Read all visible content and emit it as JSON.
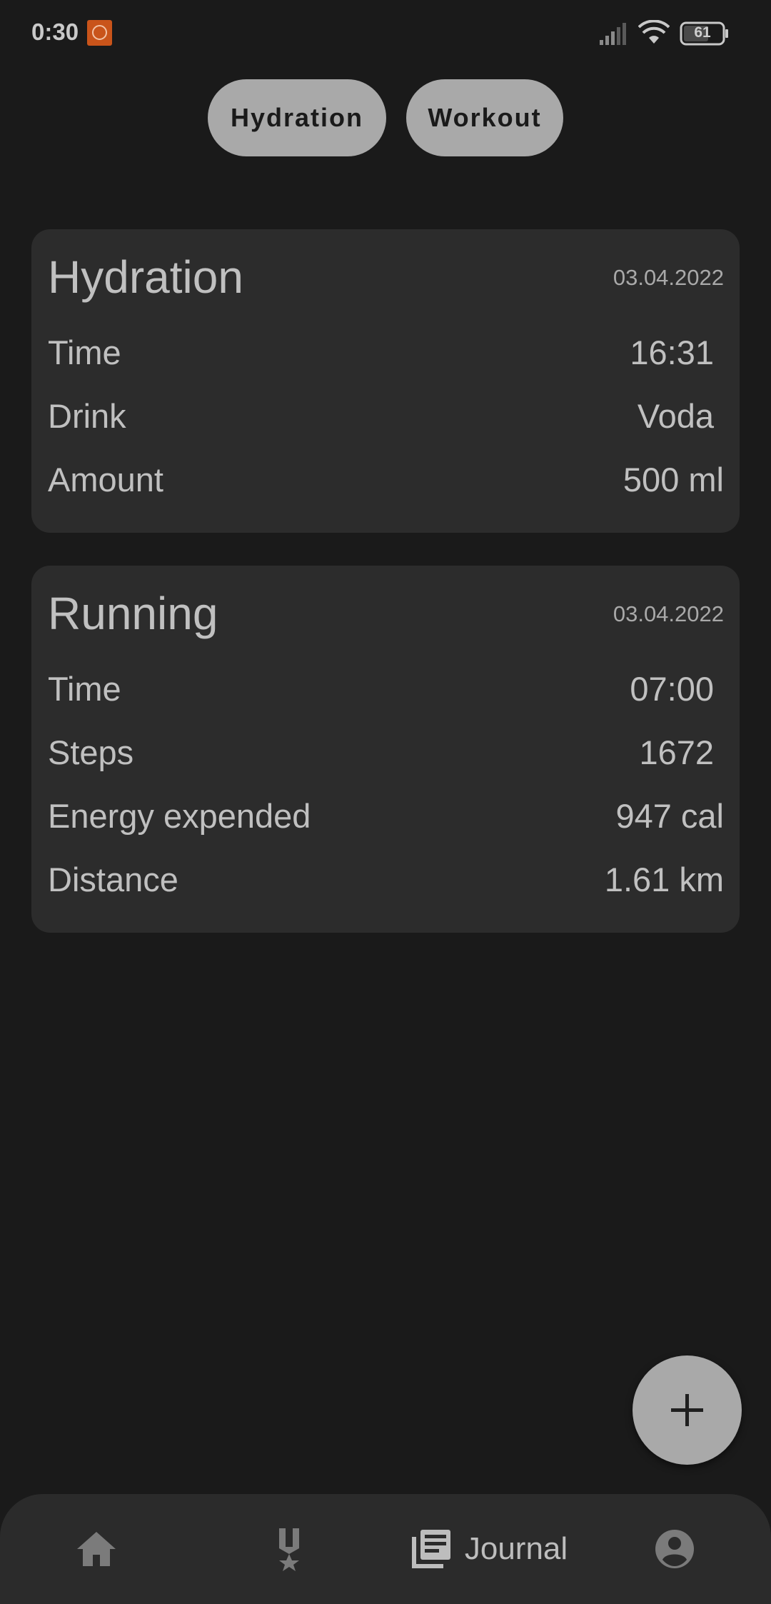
{
  "status_bar": {
    "time": "0:30",
    "battery": "61"
  },
  "filters": [
    {
      "label": "Hydration"
    },
    {
      "label": "Workout"
    }
  ],
  "cards": [
    {
      "title": "Hydration",
      "date": "03.04.2022",
      "rows": [
        {
          "label": "Time",
          "value": "16:31"
        },
        {
          "label": "Drink",
          "value": "Voda"
        },
        {
          "label": "Amount",
          "value": "500 ml"
        }
      ]
    },
    {
      "title": "Running",
      "date": "03.04.2022",
      "rows": [
        {
          "label": "Time",
          "value": "07:00"
        },
        {
          "label": "Steps",
          "value": "1672"
        },
        {
          "label": "Energy expended",
          "value": "947 cal"
        },
        {
          "label": "Distance",
          "value": "1.61 km"
        }
      ]
    }
  ],
  "fab": {
    "icon": "plus-icon"
  },
  "bottom_nav": {
    "items": [
      {
        "icon": "home-icon"
      },
      {
        "icon": "medal-icon"
      },
      {
        "icon": "journal-icon",
        "label": "Journal",
        "active": true
      },
      {
        "icon": "account-circle-icon"
      }
    ]
  },
  "colors": {
    "background": "#1a1a1a",
    "card": "#2c2c2c",
    "chip": "#a9a9a9",
    "text": "#bdbdbd",
    "status_badge": "#c9541a"
  }
}
